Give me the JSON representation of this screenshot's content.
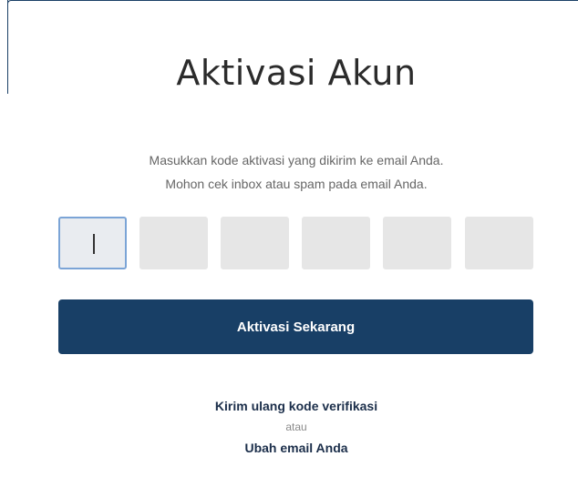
{
  "page": {
    "title": "Aktivasi Akun",
    "instructions": [
      "Masukkan kode aktivasi yang dikirim ke email Anda.",
      "Mohon cek inbox atau spam pada email Anda."
    ]
  },
  "code_inputs": {
    "count": 6,
    "values": [
      "",
      "",
      "",
      "",
      "",
      ""
    ],
    "active_index": 0
  },
  "actions": {
    "submit_label": "Aktivasi Sekarang",
    "resend_label": "Kirim ulang kode verifikasi",
    "or_label": "atau",
    "change_email_label": "Ubah email Anda"
  },
  "colors": {
    "button_bg": "#183f66",
    "input_bg": "#e6e6e6",
    "active_border": "#7ba4d6",
    "link": "#1b2e4a"
  }
}
